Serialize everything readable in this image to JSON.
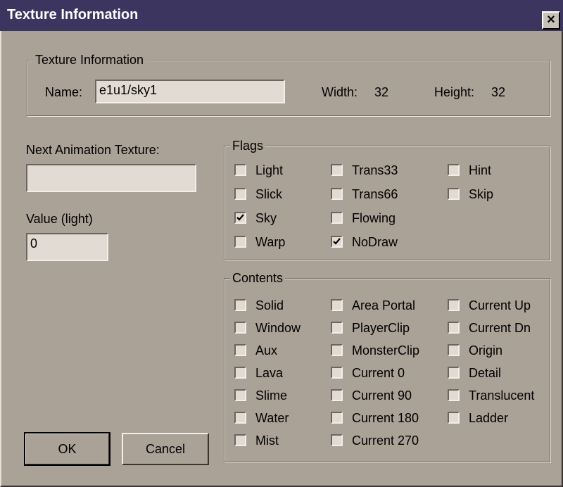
{
  "window": {
    "title": "Texture Information",
    "close_glyph": "×"
  },
  "texture_info": {
    "legend": "Texture Information",
    "name_label": "Name:",
    "name_value": "e1u1/sky1",
    "width_label": "Width:",
    "width_value": "32",
    "height_label": "Height:",
    "height_value": "32"
  },
  "next_anim": {
    "label": "Next Animation Texture:",
    "value": ""
  },
  "value_light": {
    "label": "Value (light)",
    "value": "0"
  },
  "flags": {
    "legend": "Flags",
    "items": [
      {
        "label": "Light",
        "checked": false
      },
      {
        "label": "Slick",
        "checked": false
      },
      {
        "label": "Sky",
        "checked": true
      },
      {
        "label": "Warp",
        "checked": false
      },
      {
        "label": "Trans33",
        "checked": false
      },
      {
        "label": "Trans66",
        "checked": false
      },
      {
        "label": "Flowing",
        "checked": false
      },
      {
        "label": "NoDraw",
        "checked": true
      },
      {
        "label": "Hint",
        "checked": false
      },
      {
        "label": "Skip",
        "checked": false
      }
    ]
  },
  "contents": {
    "legend": "Contents",
    "items": [
      {
        "label": "Solid",
        "checked": false
      },
      {
        "label": "Window",
        "checked": false
      },
      {
        "label": "Aux",
        "checked": false
      },
      {
        "label": "Lava",
        "checked": false
      },
      {
        "label": "Slime",
        "checked": false
      },
      {
        "label": "Water",
        "checked": false
      },
      {
        "label": "Mist",
        "checked": false
      },
      {
        "label": "Area Portal",
        "checked": false
      },
      {
        "label": "PlayerClip",
        "checked": false
      },
      {
        "label": "MonsterClip",
        "checked": false
      },
      {
        "label": "Current 0",
        "checked": false
      },
      {
        "label": "Current 90",
        "checked": false
      },
      {
        "label": "Current 180",
        "checked": false
      },
      {
        "label": "Current 270",
        "checked": false
      },
      {
        "label": "Current Up",
        "checked": false
      },
      {
        "label": "Current Dn",
        "checked": false
      },
      {
        "label": "Origin",
        "checked": false
      },
      {
        "label": "Detail",
        "checked": false
      },
      {
        "label": "Translucent",
        "checked": false
      },
      {
        "label": "Ladder",
        "checked": false
      }
    ]
  },
  "buttons": {
    "ok": "OK",
    "cancel": "Cancel"
  },
  "colors": {
    "title_bar": "#3c3560",
    "dialog_bg": "#aaa197",
    "field_bg": "#e1dbd3"
  }
}
